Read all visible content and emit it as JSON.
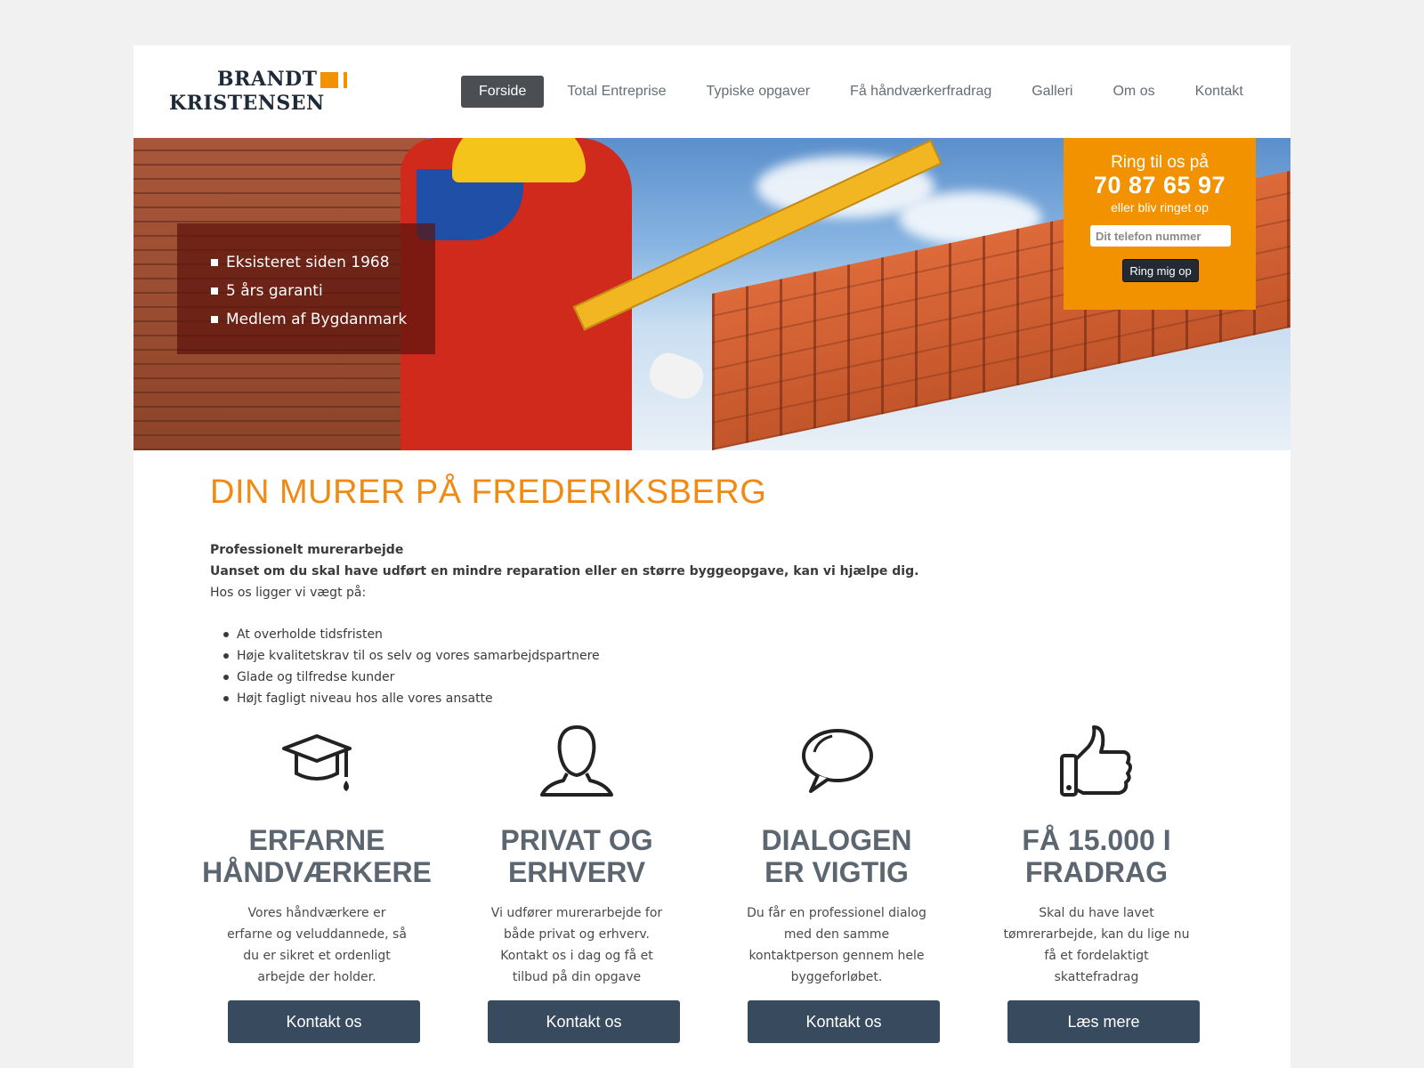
{
  "header": {
    "logo_line1": "BRANDT",
    "logo_line2": "KRISTENSEN",
    "nav": [
      {
        "label": "Forside",
        "active": true
      },
      {
        "label": "Total Entreprise"
      },
      {
        "label": "Typiske opgaver"
      },
      {
        "label": "Få håndværkerfradrag"
      },
      {
        "label": "Galleri"
      },
      {
        "label": "Om os"
      },
      {
        "label": "Kontakt"
      }
    ]
  },
  "hero": {
    "bullets": [
      "Eksisteret siden 1968",
      "5 års garanti",
      "Medlem af Bygdanmark"
    ],
    "callbox": {
      "line1": "Ring til os på",
      "phone": "70 87 65 97",
      "line2": "eller bliv ringet op",
      "input_placeholder": "Dit telefon nummer",
      "button_label": "Ring mig op"
    }
  },
  "main": {
    "title": "DIN MURER PÅ FREDERIKSBERG",
    "intro_bold1": "Professionelt murerarbejde",
    "intro_bold2": "Uanset om du skal have udført en mindre reparation eller en større byggeopgave, kan vi hjælpe dig.",
    "intro_text": "Hos os ligger vi vægt på:",
    "values": [
      "At overholde tidsfristen",
      "Høje kvalitetskrav til os selv og vores samarbejdspartnere",
      "Glade og tilfredse kunder",
      "Højt fagligt niveau hos alle vores ansatte"
    ]
  },
  "features": [
    {
      "icon": "graduation-cap-icon",
      "title_l1": "ERFARNE",
      "title_l2": "HÅNDVÆRKERE",
      "text": "Vores håndværkere er erfarne og veluddannede, så du er sikret et ordenligt arbejde der holder.",
      "button": "Kontakt os"
    },
    {
      "icon": "person-icon",
      "title_l1": "PRIVAT OG",
      "title_l2": "ERHVERV",
      "text": "Vi udfører murerarbejde for både privat og erhverv. Kontakt os i dag og få et tilbud på din opgave",
      "button": "Kontakt os"
    },
    {
      "icon": "speech-bubble-icon",
      "title_l1": "DIALOGEN",
      "title_l2": "ER VIGTIG",
      "text": "Du får en professionel dialog med den samme kontaktperson gennem hele byggeforløbet.",
      "button": "Kontakt os"
    },
    {
      "icon": "thumbs-up-icon",
      "title_l1": "FÅ 15.000 I",
      "title_l2": "FRADRAG",
      "text": "Skal du have lavet tømrerarbejde, kan du lige nu få et fordelaktigt skattefradrag",
      "button": "Læs mere"
    }
  ],
  "colors": {
    "accent": "#f39200",
    "title_orange": "#f08a12",
    "button_blue": "#374a5e",
    "nav_active": "#4b4f53"
  }
}
